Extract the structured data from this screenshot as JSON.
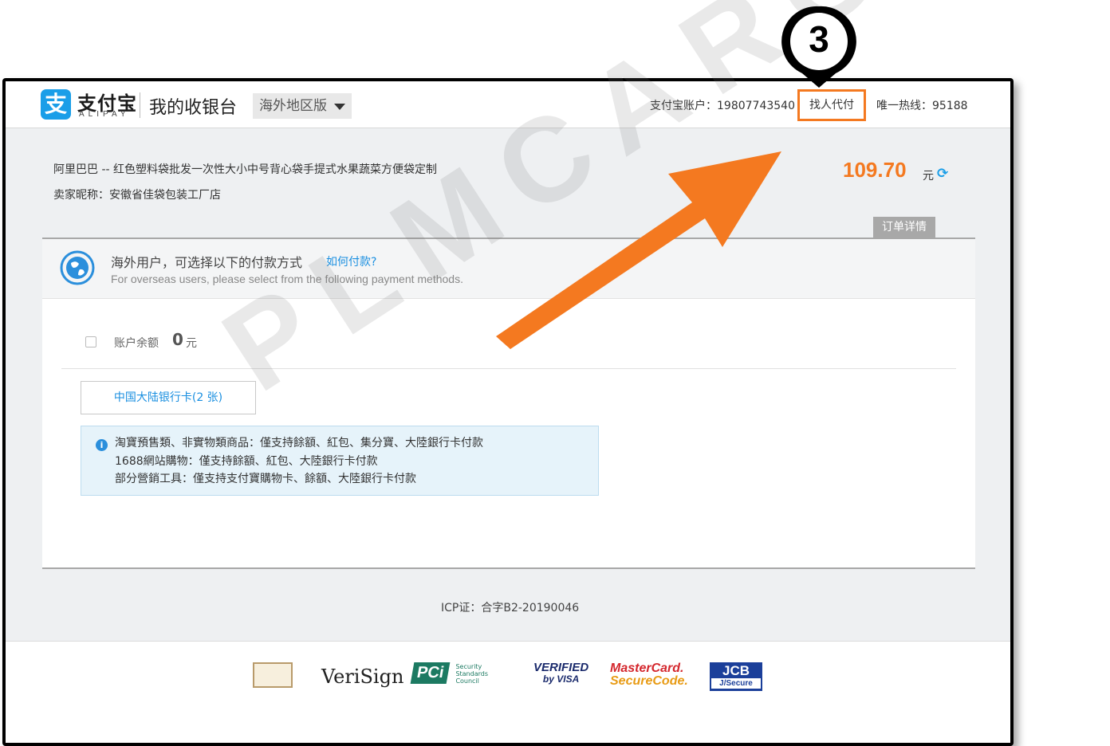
{
  "header": {
    "logo_char": "支",
    "logo_text": "支付宝",
    "logo_sub": "ALIPAY",
    "cashier_title": "我的收银台",
    "region_label": "海外地区版",
    "account": "支付宝账户：19807743540",
    "pay_for_me": "找人代付",
    "hotline": "唯一热线：95188"
  },
  "order": {
    "title": "阿里巴巴 -- 红色塑料袋批发一次性大小中号背心袋手提式水果蔬菜方便袋定制",
    "seller": "卖家昵称：安徽省佳袋包装工厂店",
    "amount": "109.70",
    "currency": "元",
    "detail_button": "订单详情"
  },
  "notice": {
    "cn": "海外用户，可选择以下的付款方式",
    "link": "如何付款?",
    "en": "For overseas users, please select from the following payment methods."
  },
  "balance": {
    "label": "账户余额",
    "value": "0",
    "unit": "元"
  },
  "card_button": "中国大陆银行卡(2 张)",
  "info": {
    "icon": "i",
    "lines": [
      "淘寶預售類、非實物類商品：僅支持餘額、紅包、集分寶、大陸銀行卡付款",
      "1688網站購物：僅支持餘額、紅包、大陸銀行卡付款",
      "部分營銷工具：僅支持支付寶購物卡、餘額、大陸銀行卡付款"
    ]
  },
  "icp": "ICP证：合字B2-20190046",
  "footer_badges": {
    "verisign": "VeriSign",
    "pci": "PCi",
    "pci_sub": "Security Standards Council",
    "visa_1": "VERIFIED",
    "visa_2": "by VISA",
    "mc_1": "MasterCard.",
    "mc_2": "SecureCode.",
    "jcb_1": "JCB",
    "jcb_2": "J/Secure"
  },
  "annotation": {
    "step_number": "3",
    "watermark": "PLMCARGO",
    "arrow_color": "#f47920"
  },
  "colors": {
    "accent_orange": "#f47920",
    "link_blue": "#1a8fe0",
    "alipay_blue": "#1a9ee8"
  }
}
